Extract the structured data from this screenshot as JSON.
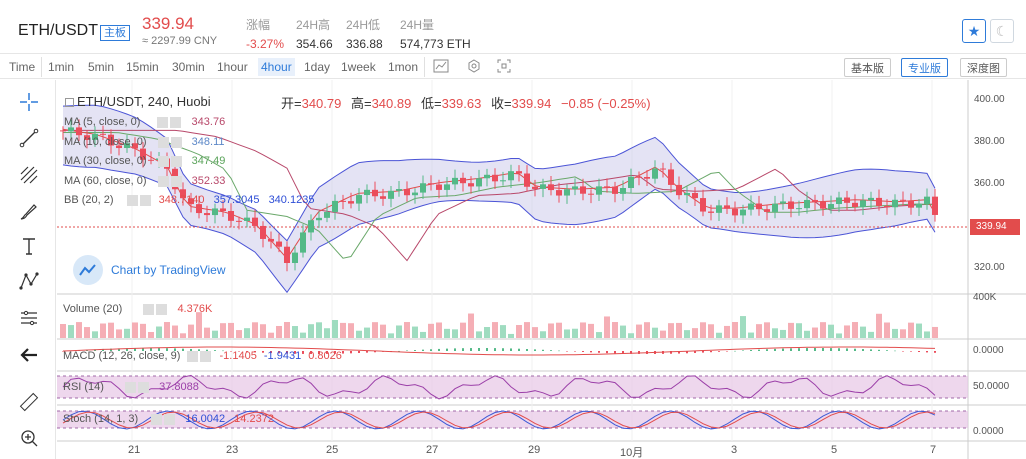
{
  "header": {
    "pair": "ETH/USDT",
    "board": "主板",
    "price": "339.94",
    "price_cny": "≈ 2297.99 CNY",
    "stats": [
      {
        "label": "涨幅",
        "value": "-3.27%"
      },
      {
        "label": "24H高",
        "value": "354.66"
      },
      {
        "label": "24H低",
        "value": "336.88"
      },
      {
        "label": "24H量",
        "value": "574,773 ETH"
      }
    ],
    "favorite_icon": "star-icon",
    "theme_icon": "moon-icon"
  },
  "toolbar": {
    "intervals": [
      "Time",
      "1min",
      "5min",
      "15min",
      "30min",
      "1hour",
      "4hour",
      "1day",
      "1week",
      "1mon"
    ],
    "active_interval": "4hour",
    "icons": [
      "indicators-icon",
      "settings-icon",
      "fullscreen-icon"
    ],
    "views": [
      "基本版",
      "专业版",
      "深度图"
    ],
    "active_view": "专业版"
  },
  "left_tools": [
    "crosshair-icon",
    "trend-line-icon",
    "fib-icon",
    "brush-icon",
    "text-icon",
    "pattern-icon",
    "measure-icon",
    "back-arrow-icon",
    "ruler-icon",
    "zoom-in-icon"
  ],
  "chart": {
    "title": "ETH/USDT, 240, Huobi",
    "ohlc": [
      {
        "k": "开=",
        "v": "340.79"
      },
      {
        "k": "高=",
        "v": "340.89"
      },
      {
        "k": "低=",
        "v": "339.63"
      },
      {
        "k": "收=",
        "v": "339.94"
      },
      {
        "k": "",
        "v": "−0.85 (−0.25%)"
      }
    ],
    "ma": [
      {
        "name": "MA (5, close, 0)",
        "value": "343.76",
        "color": "#b8486a"
      },
      {
        "name": "MA (10, close, 0)",
        "value": "348.11",
        "color": "#5b87c7"
      },
      {
        "name": "MA (30, close, 0)",
        "value": "347.49",
        "color": "#5aa35a"
      },
      {
        "name": "MA (60, close, 0)",
        "value": "352.33",
        "color": "#b8486a"
      }
    ],
    "bb": {
      "name": "BB (20, 2)",
      "values": [
        "348.7140",
        "357.3045",
        "340.1235"
      ]
    },
    "branding": "Chart by TradingView",
    "current_price": "339.94",
    "y_ticks": [
      "400.00",
      "380.00",
      "360.00",
      "340.00",
      "320.00"
    ],
    "x_ticks": [
      "21",
      "23",
      "25",
      "27",
      "29",
      "10月",
      "3",
      "5",
      "7"
    ],
    "volume": {
      "name": "Volume (20)",
      "value": "4.376K",
      "axis": "400K"
    },
    "macd": {
      "name": "MACD (12, 26, close, 9)",
      "values": [
        "-1.1405",
        "-1.9431",
        "0.8026"
      ],
      "axis": "0.0000"
    },
    "rsi": {
      "name": "RSI (14)",
      "value": "37.8088",
      "axis": "50.0000"
    },
    "stoch": {
      "name": "Stoch (14, 1, 3)",
      "values": [
        "16.0042",
        "14.2372"
      ],
      "axis": "0.0000"
    }
  }
}
